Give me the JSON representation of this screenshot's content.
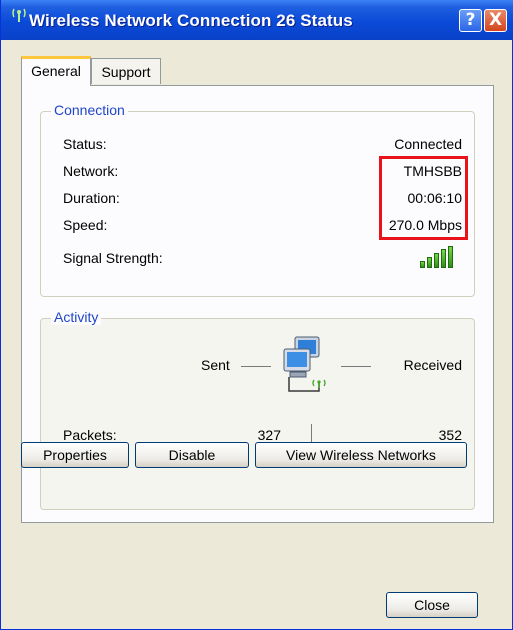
{
  "window": {
    "title": "Wireless Network Connection 26 Status"
  },
  "title_controls": {
    "help_label": "?",
    "close_label": "X"
  },
  "tabs": [
    {
      "label": "General",
      "active": true
    },
    {
      "label": "Support",
      "active": false
    }
  ],
  "connection": {
    "group_title": "Connection",
    "status_label": "Status:",
    "status_value": "Connected",
    "network_label": "Network:",
    "network_value": "TMHSBB",
    "duration_label": "Duration:",
    "duration_value": "00:06:10",
    "speed_label": "Speed:",
    "speed_value": "270.0 Mbps",
    "signal_label": "Signal Strength:",
    "signal_bars": 5,
    "signal_color": "#3fa626",
    "highlight_color": "#e8131b"
  },
  "activity": {
    "group_title": "Activity",
    "sent_label": "Sent",
    "received_label": "Received",
    "packets_label": "Packets:",
    "packets_sent": "327",
    "packets_received": "352"
  },
  "buttons": {
    "properties": "Properties",
    "disable": "Disable",
    "view_wireless": "View Wireless Networks",
    "close": "Close"
  },
  "icons": {
    "title_icon": "wireless-antenna-icon",
    "activity_icon": "network-computers-icon"
  }
}
